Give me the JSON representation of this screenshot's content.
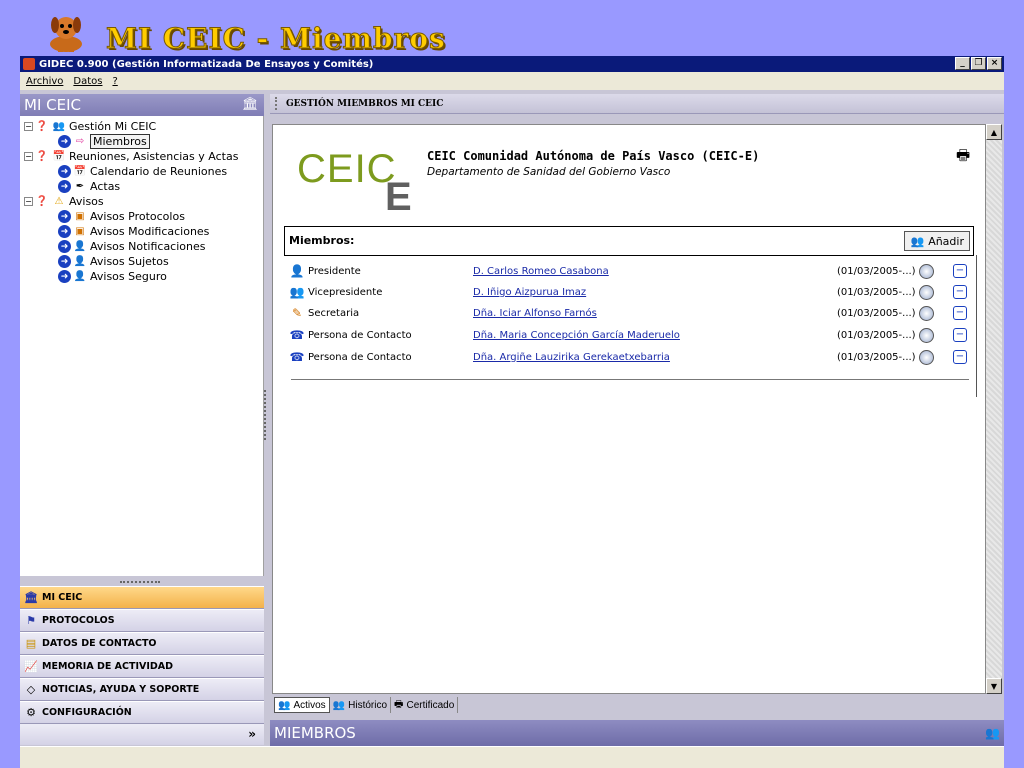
{
  "banner": {
    "title": "MI CEIC - Miembros"
  },
  "window": {
    "title": "GIDEC 0.900 (Gestión Informatizada De Ensayos y Comités)"
  },
  "menu": [
    "Archivo",
    "Datos",
    "?"
  ],
  "left_panel": {
    "title": "MI CEIC",
    "tree": [
      {
        "label": "Gestión Mi CEIC",
        "level": 0
      },
      {
        "label": "Miembros",
        "level": 1,
        "selected": true
      },
      {
        "label": "Reuniones, Asistencias y Actas",
        "level": 0
      },
      {
        "label": "Calendario de Reuniones",
        "level": 1
      },
      {
        "label": "Actas",
        "level": 1
      },
      {
        "label": "Avisos",
        "level": 0
      },
      {
        "label": "Avisos Protocolos",
        "level": 1
      },
      {
        "label": "Avisos Modificaciones",
        "level": 1
      },
      {
        "label": "Avisos Notificaciones",
        "level": 1
      },
      {
        "label": "Avisos Sujetos",
        "level": 1
      },
      {
        "label": "Avisos Seguro",
        "level": 1
      }
    ],
    "nav": [
      {
        "label": "MI CEIC",
        "icon": "bank-icon",
        "active": true
      },
      {
        "label": "PROTOCOLOS",
        "icon": "flag-icon"
      },
      {
        "label": "DATOS DE CONTACTO",
        "icon": "address-book-icon"
      },
      {
        "label": "MEMORIA DE ACTIVIDAD",
        "icon": "chart-icon"
      },
      {
        "label": "NOTICIAS, AYUDA Y SOPORTE",
        "icon": "diamond-icon"
      },
      {
        "label": "CONFIGURACIÓN",
        "icon": "settings-icon"
      }
    ]
  },
  "right_panel": {
    "header": "GESTIÓN MIEMBROS MI CEIC",
    "logo_text": "CEIC",
    "logo_e": "E",
    "org_name": "CEIC Comunidad Autónoma de País Vasco (CEIC-E)",
    "org_sub": "Departamento de Sanidad del Gobierno Vasco",
    "members_label": "Miembros:",
    "add_label": "Añadir",
    "members": [
      {
        "role": "Presidente",
        "name": "D. Carlos Romeo Casabona",
        "date": "(01/03/2005-...)"
      },
      {
        "role": "Vicepresidente",
        "name": "D. Iñigo Aizpurua Imaz",
        "date": "(01/03/2005-...)"
      },
      {
        "role": "Secretaria",
        "name": "Dña. Iciar Alfonso Farnós",
        "date": "(01/03/2005-...)"
      },
      {
        "role": "Persona de Contacto",
        "name": "Dña. Maria Concepción García Maderuelo",
        "date": "(01/03/2005-...)"
      },
      {
        "role": "Persona de Contacto",
        "name": "Dña. Argiñe Lauzirika Gerekaetxebarria",
        "date": "(01/03/2005-...)"
      }
    ],
    "tabs": [
      "Activos",
      "Histórico",
      "Certificado"
    ],
    "footer_title": "MIEMBROS"
  }
}
